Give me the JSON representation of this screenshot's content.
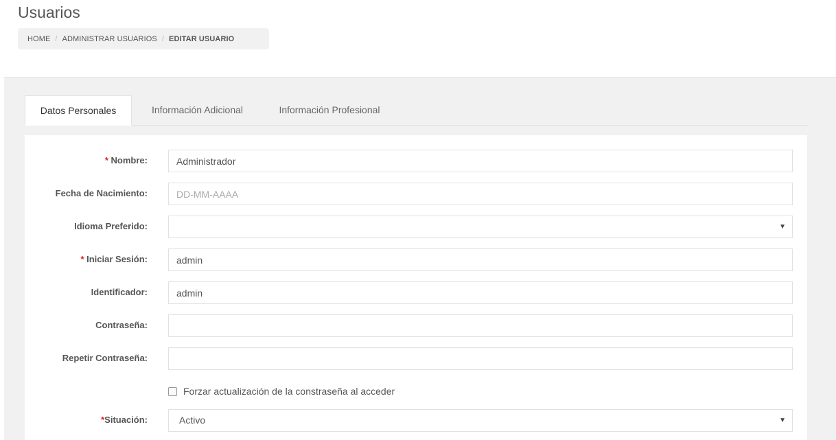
{
  "page": {
    "title": "Usuarios"
  },
  "breadcrumb": {
    "items": [
      "HOME",
      "ADMINISTRAR USUARIOS",
      "EDITAR USUARIO"
    ],
    "separator": "/"
  },
  "tabs": [
    {
      "label": "Datos Personales",
      "active": true
    },
    {
      "label": "Información Adicional",
      "active": false
    },
    {
      "label": "Información Profesional",
      "active": false
    }
  ],
  "form": {
    "nombre": {
      "required_mark": "*",
      "label": "Nombre:",
      "value": "Administrador"
    },
    "fecha": {
      "label": "Fecha de Nacimiento:",
      "value": "",
      "placeholder": "DD-MM-AAAA"
    },
    "idioma": {
      "label": "Idioma Preferido:",
      "value": "",
      "arrow": "▼"
    },
    "iniciar": {
      "required_mark": "*",
      "label": "Iniciar Sesión:",
      "value": "admin"
    },
    "identificador": {
      "label": "Identificador:",
      "value": "admin"
    },
    "contrasena": {
      "label": "Contraseña:",
      "value": ""
    },
    "repetir": {
      "label": "Repetir Contraseña:",
      "value": ""
    },
    "forzar": {
      "label": "Forzar actualización de la constraseña al acceder",
      "checked": false
    },
    "situacion": {
      "required_mark": "*",
      "label": "Situación:",
      "value": "Activo",
      "arrow": "▼"
    }
  },
  "colors": {
    "required": "#e02222",
    "background": "#f1f1f1",
    "panel": "#ffffff"
  }
}
